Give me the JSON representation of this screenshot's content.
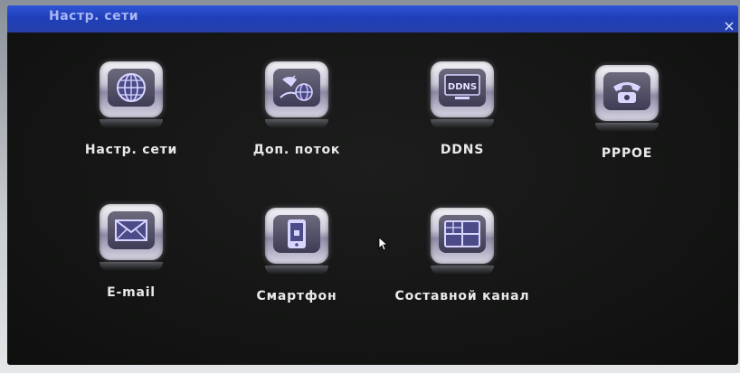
{
  "window": {
    "title": "Настр. сети",
    "close_glyph": "×"
  },
  "tiles": [
    {
      "label": "Настр. сети",
      "icon": "globe-icon"
    },
    {
      "label": "Доп. поток",
      "icon": "satellite-globe-icon"
    },
    {
      "label": "DDNS",
      "icon": "ddns-monitor-icon",
      "icon_text": "DDNS"
    },
    {
      "label": "PPPOE",
      "icon": "telephone-icon"
    },
    {
      "label": "E-mail",
      "icon": "envelope-icon"
    },
    {
      "label": "Смартфон",
      "icon": "smartphone-icon"
    },
    {
      "label": "Составной канал",
      "icon": "multi-channel-grid-icon"
    }
  ],
  "colors": {
    "titlebar": "#1f3fb9",
    "background": "#141514",
    "label": "#e9e9ea"
  }
}
